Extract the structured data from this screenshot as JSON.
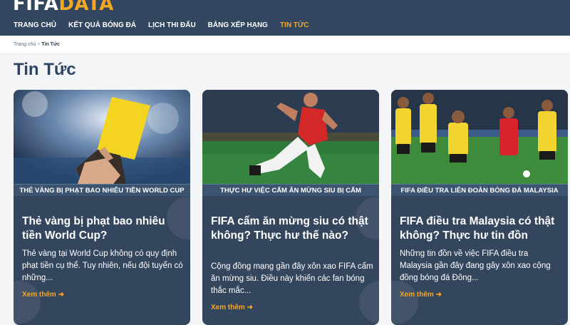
{
  "header": {
    "logo_part1": "FIFA",
    "logo_part2": "DATA",
    "nav": [
      {
        "label": "TRANG CHỦ"
      },
      {
        "label": "KẾT QUẢ BÓNG ĐÁ"
      },
      {
        "label": "LỊCH THI ĐẤU"
      },
      {
        "label": "BẢNG XẾP HẠNG"
      },
      {
        "label": "TIN TỨC"
      }
    ]
  },
  "breadcrumb": {
    "home": "Trang chủ",
    "separator": ">",
    "current": "Tin Tức"
  },
  "page_title": "Tin Tức",
  "colors": {
    "header_bg": "#33465f",
    "accent": "#f5a623",
    "card_bg": "#34465e"
  },
  "cards": [
    {
      "caption": "THẺ VÀNG BỊ PHẠT BAO NHIÊU TIỀN WORLD CUP",
      "title": "Thẻ vàng bị phạt bao nhiêu tiền World Cup?",
      "excerpt": "Thẻ vàng tại World Cup không có quy định phạt tiền cụ thể. Tuy nhiên, nếu đội tuyển có những...",
      "more": "Xem thêm ➜"
    },
    {
      "caption": "THỰC HƯ VIỆC CẤM ĂN MỪNG SIU BỊ CẤM",
      "title": "FIFA cấm ăn mừng siu có thật không? Thực hư thế nào?",
      "excerpt": "Cộng đồng mạng gần đây xôn xao FIFA cấm ăn mừng siu. Điều này khiến các fan bóng thắc mắc...",
      "more": "Xem thêm ➜"
    },
    {
      "caption": "FIFA ĐIỀU TRA LIÊN ĐOÀN BÓNG ĐÁ MALAYSIA",
      "title": "FIFA điều tra Malaysia có thật không? Thực hư tin đồn",
      "excerpt": "Những tin đồn về việc FIFA điều tra Malaysia gần đây đang gây xôn xao cộng đồng bóng đá Đông...",
      "more": "Xem thêm ➜"
    }
  ]
}
